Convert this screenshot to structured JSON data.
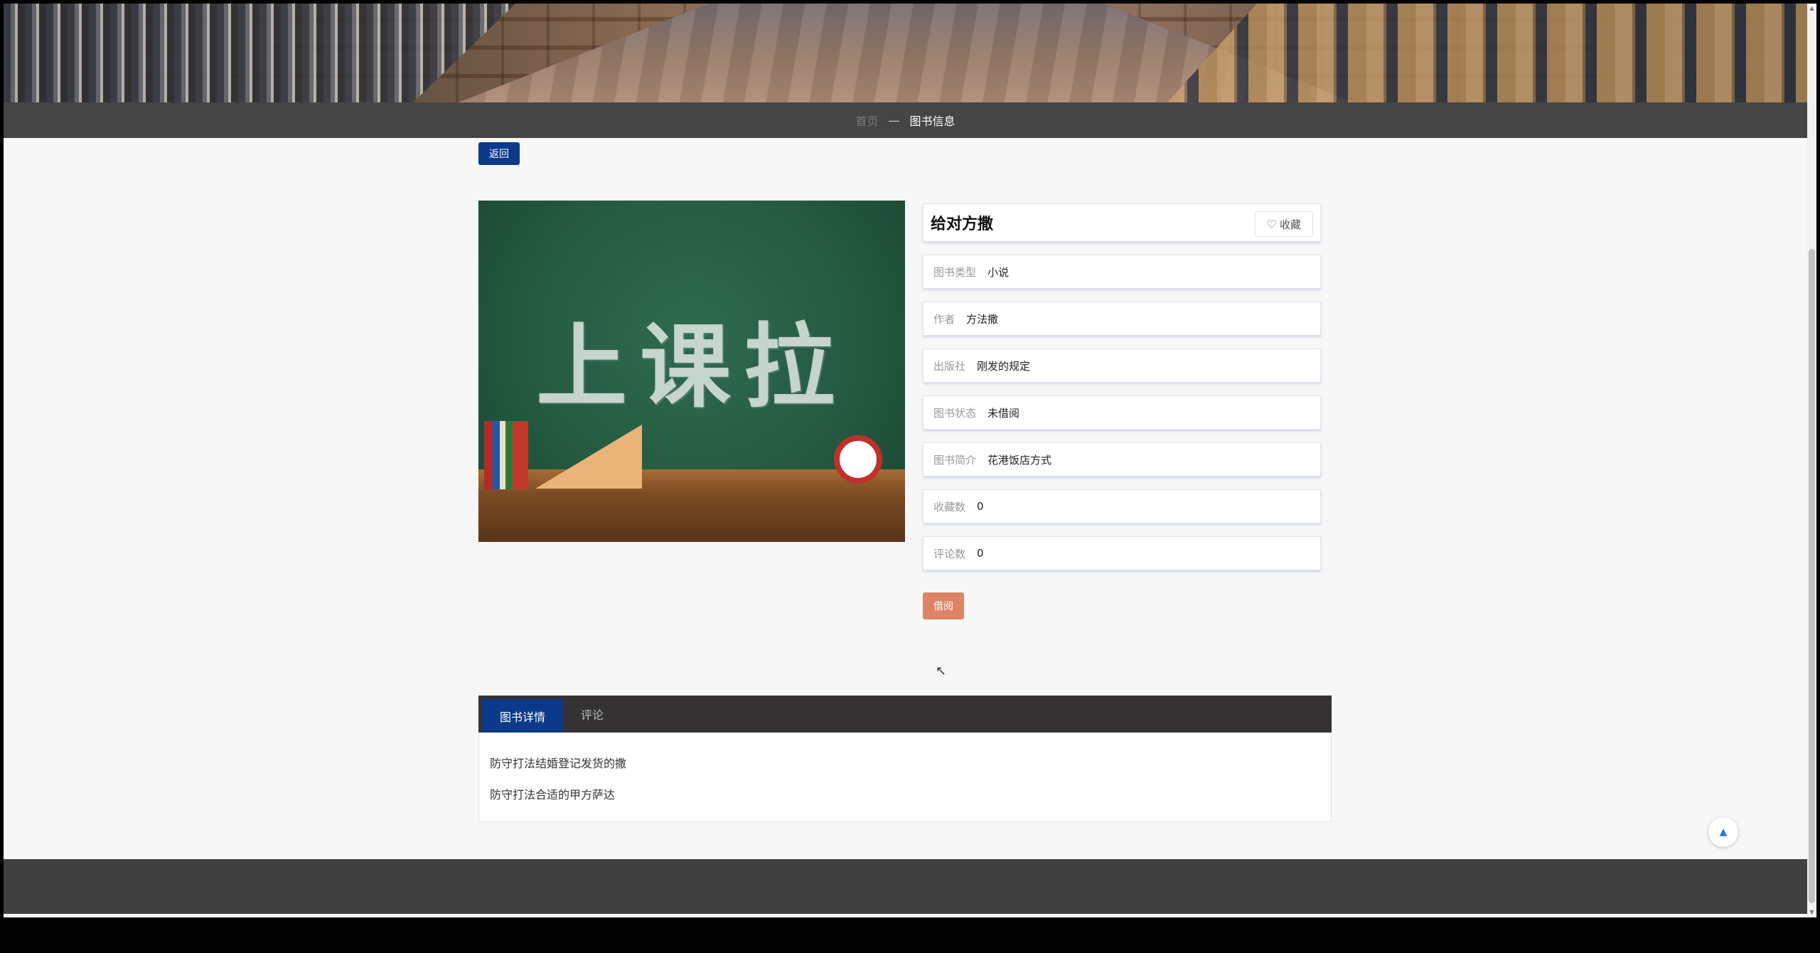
{
  "breadcrumb": {
    "home": "首页",
    "separator": "—",
    "current": "图书信息"
  },
  "back_label": "返回",
  "cover": {
    "chalk_text": "上课拉"
  },
  "book": {
    "title": "给对方撒",
    "favorite_label": "收藏",
    "fields": [
      {
        "label": "图书类型",
        "value": "小说"
      },
      {
        "label": "作者",
        "value": "方法撒"
      },
      {
        "label": "出版社",
        "value": "刚发的规定"
      },
      {
        "label": "图书状态",
        "value": "未借阅"
      },
      {
        "label": "图书简介",
        "value": "花港饭店方式"
      },
      {
        "label": "收藏数",
        "value": "0"
      },
      {
        "label": "评论数",
        "value": "0"
      }
    ],
    "borrow_label": "借阅"
  },
  "tabs": [
    {
      "label": "图书详情",
      "active": true
    },
    {
      "label": "评论",
      "active": false
    }
  ],
  "details": {
    "lines": [
      "防守打法结婚登记发货的撒",
      "防守打法合适的甲方萨达"
    ]
  },
  "icons": {
    "favorite": "heart-icon",
    "back_to_top": "triangle-up-icon"
  },
  "colors": {
    "primary": "#0b3a8c",
    "borrow": "#dc8466",
    "tab_bar": "#353233",
    "footer": "#404040"
  }
}
